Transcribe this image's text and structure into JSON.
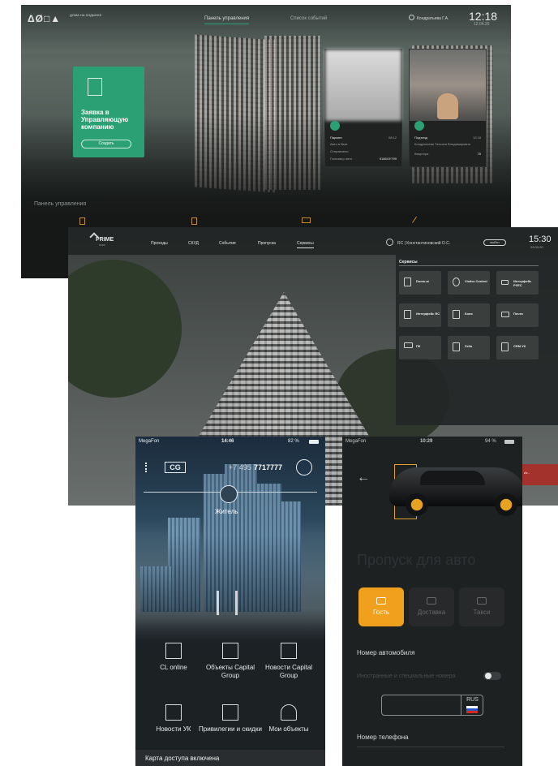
{
  "screen1": {
    "logo": "ΔØ□▲",
    "logo_sub": "ДОМА НА ХОДЫНКЕ",
    "nav": [
      "Панель управления",
      "Список событий"
    ],
    "user": "Кондратьева Г.А.",
    "time": "12:18",
    "date": "12.04.20",
    "request_card": {
      "title": "Заявка в Управляющую компанию",
      "button": "Создать"
    },
    "camera1": {
      "title": "Паркинг",
      "time": "08:12",
      "rows": [
        [
          "Авто в базе",
          ""
        ],
        [
          "Отправлено",
          ""
        ],
        [
          "Госномер авто",
          "К186ОУ799"
        ]
      ]
    },
    "camera2": {
      "title": "Подъезд",
      "time": "12:18",
      "subtitle": "Кондратьева Татьяна Владимировна",
      "rows": [
        [
          "Квартира",
          "75"
        ]
      ]
    },
    "panel_title": "Панель управления"
  },
  "screen2": {
    "logo": "PRIME",
    "logo_sub": "PARK",
    "nav": [
      "Проходы",
      "СКУД",
      "События",
      "Пропуска",
      "Сервисы"
    ],
    "active_nav": "Сервисы",
    "user": "RC | Константиновский О.С.",
    "exit_button": "выйти",
    "time": "15:30",
    "date": "29.03.20",
    "services_title": "Сервисы",
    "services": [
      [
        "Domo.ai",
        "Visitor Control",
        "Интерфейс РУЕС"
      ],
      [
        "Интерфейс RC",
        "Коля",
        "Почта"
      ],
      [
        "ПК",
        "Zello",
        "CRM УК"
      ]
    ],
    "alert_text": "Ат..."
  },
  "screen3": {
    "status_left": "MegaFon",
    "status_time": "14:46",
    "status_right": "82 %",
    "logo": "CG",
    "phone_prefix": "+7 495",
    "phone_number": "7717777",
    "role": "Житель",
    "tiles": [
      {
        "label": "CL online"
      },
      {
        "label": "Объекты Capital Group"
      },
      {
        "label": "Новости Capital Group"
      },
      {
        "label": "Новости УК"
      },
      {
        "label": "Привилегии и скидки"
      },
      {
        "label": "Мои объекты"
      }
    ],
    "bottom_bar": "Карта доступа включена"
  },
  "screen4": {
    "status_left": "MegaFon",
    "status_time": "10:29",
    "status_right": "94 %",
    "title": "Пропуск для авто",
    "tabs": [
      "Гость",
      "Доставка",
      "Такси"
    ],
    "active_tab": "Гость",
    "car_number_label": "Номер автомобиля",
    "foreign_numbers_label": "Иностранные и специальные номера",
    "region_code": "RUS",
    "phone_label": "Номер телефона"
  },
  "colors": {
    "green": "#2aa074",
    "orange": "#f0a01c",
    "dark": "#1e2122"
  }
}
